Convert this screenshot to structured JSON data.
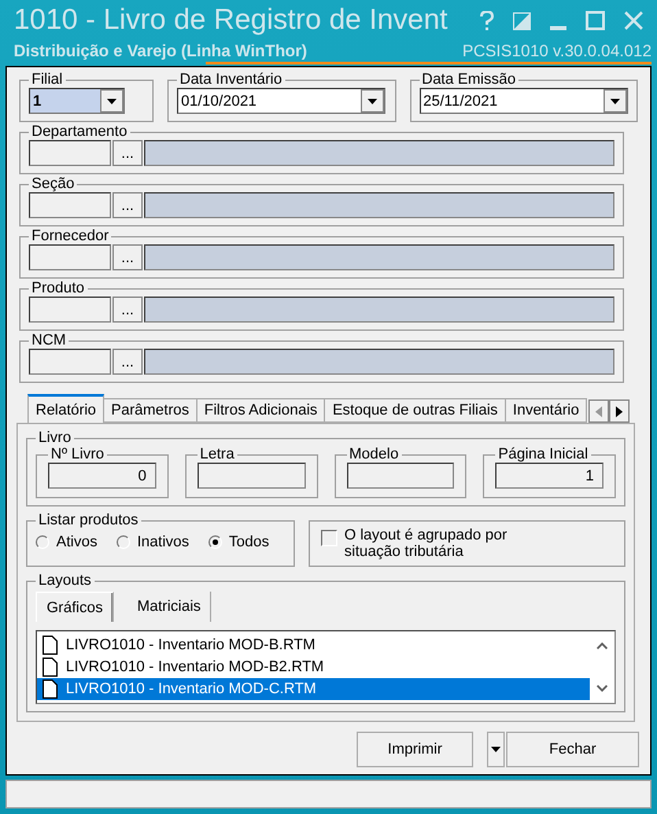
{
  "window": {
    "title": "1010 - Livro de Registro de Invent",
    "subtitle": "Distribuição e Varejo (Linha WinThor)",
    "version": "PCSIS1010  v.30.0.04.012"
  },
  "header_fields": [
    {
      "label": "Filial",
      "value": "1",
      "focused": true
    },
    {
      "label": "Data Inventário",
      "value": "01/10/2021",
      "focused": false
    },
    {
      "label": "Data Emissão",
      "value": "25/11/2021",
      "focused": false
    }
  ],
  "lookups": [
    {
      "label": "Departamento",
      "button": "..."
    },
    {
      "label": "Seção",
      "button": "..."
    },
    {
      "label": "Fornecedor",
      "button": "..."
    },
    {
      "label": "Produto",
      "button": "..."
    },
    {
      "label": "NCM",
      "button": "..."
    }
  ],
  "tabs": [
    {
      "label": "Relatório",
      "selected": true
    },
    {
      "label": "Parâmetros",
      "selected": false
    },
    {
      "label": "Filtros Adicionais",
      "selected": false
    },
    {
      "label": "Estoque de outras Filiais",
      "selected": false
    },
    {
      "label": "Inventário",
      "selected": false
    }
  ],
  "livro": {
    "label": "Livro",
    "fields": [
      {
        "label": "Nº Livro",
        "value": "0"
      },
      {
        "label": "Letra"
      },
      {
        "label": "Modelo"
      },
      {
        "label": "Página Inicial",
        "value": "1"
      }
    ]
  },
  "listar_produtos": {
    "label": "Listar produtos",
    "options": [
      {
        "label": "Ativos",
        "selected": false
      },
      {
        "label": "Inativos",
        "selected": false
      },
      {
        "label": "Todos",
        "selected": true
      }
    ]
  },
  "agrupado": {
    "label": "O layout é agrupado por situação tributária",
    "checked": false
  },
  "layouts": {
    "label": "Layouts",
    "tabs": [
      {
        "label": "Gráficos",
        "selected": true
      },
      {
        "label": "Matriciais",
        "selected": false
      }
    ],
    "files": [
      {
        "name": "LIVRO1010 - Inventario MOD-B.RTM",
        "selected": false
      },
      {
        "name": "LIVRO1010 - Inventario MOD-B2.RTM",
        "selected": false
      },
      {
        "name": "LIVRO1010 - Inventario MOD-C.RTM",
        "selected": true
      }
    ]
  },
  "buttons": [
    {
      "label": "Imprimir",
      "kind": "split"
    },
    {
      "label": "Fechar",
      "kind": "plain"
    }
  ]
}
